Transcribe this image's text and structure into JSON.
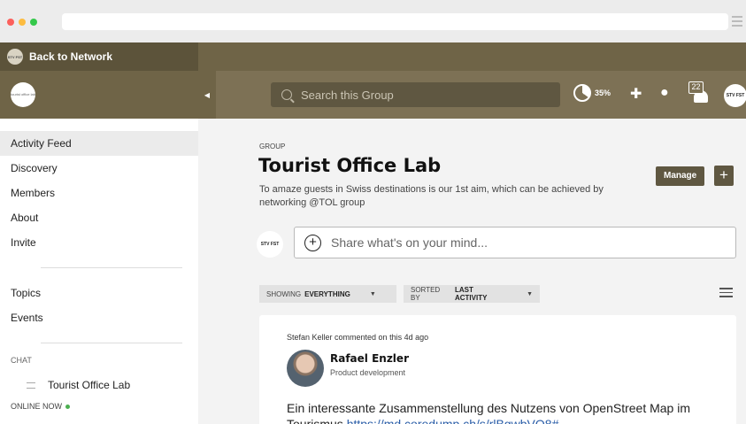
{
  "topbar": {
    "back_label": "Back to Network",
    "logo_text": "STV FST"
  },
  "header": {
    "group_logo_text": "tourist office lab",
    "search_placeholder": "Search this Group",
    "progress": {
      "label": "35%",
      "value": 0.35
    },
    "notification_count": "22",
    "avatar_text": "STV FST"
  },
  "sidebar": {
    "items": [
      {
        "label": "Activity Feed"
      },
      {
        "label": "Discovery"
      },
      {
        "label": "Members"
      },
      {
        "label": "About"
      },
      {
        "label": "Invite"
      }
    ],
    "items2": [
      {
        "label": "Topics"
      },
      {
        "label": "Events"
      }
    ],
    "chat_label": "CHAT",
    "chat_item": "Tourist Office Lab",
    "online_label": "ONLINE NOW"
  },
  "main": {
    "eyebrow": "GROUP",
    "title": "Tourist Office Lab",
    "description": "To amaze guests in Swiss destinations is our 1st aim, which can be achieved by networking @TOL group",
    "manage_label": "Manage",
    "plus_label": "+",
    "composer_avatar_text": "STV FST",
    "composer_placeholder": "Share what's on your mind...",
    "filter_show": {
      "prefix": "SHOWING",
      "value": "EVERYTHING"
    },
    "filter_sort": {
      "prefix": "SORTED BY",
      "value": "LAST ACTIVITY"
    }
  },
  "post": {
    "activity": "Stefan Keller commented on this 4d ago",
    "author": "Rafael Enzler",
    "role": "Product development",
    "text": "Ein interessante Zusammenstellung des Nutzens von OpenStreet Map im Tourismus",
    "link": "https://md.coredump.ch/s/rlBgwbVQ8#"
  },
  "colors": {
    "dark": "#5c533a",
    "header": "#7d7155",
    "accent": "#5f5741"
  }
}
